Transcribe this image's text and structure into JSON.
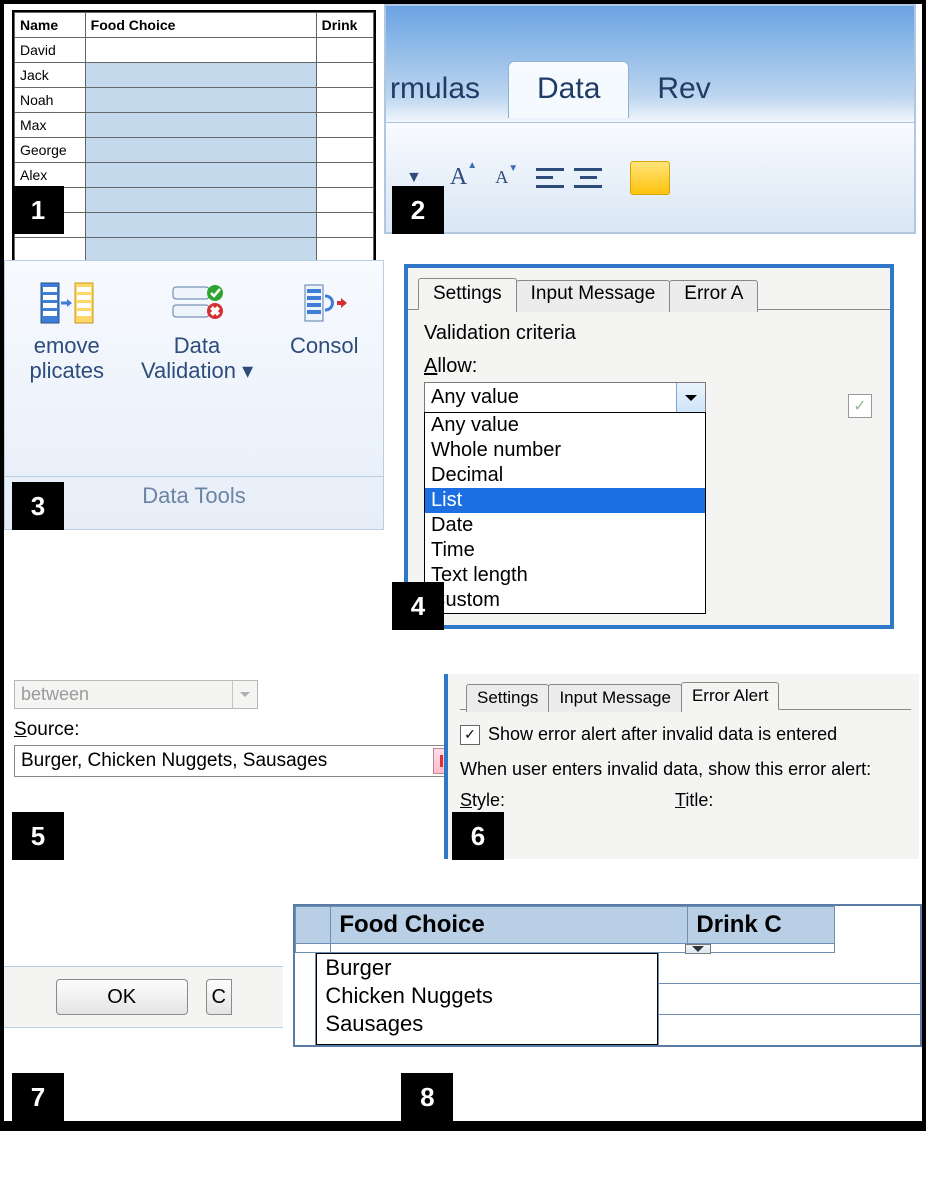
{
  "panel1": {
    "headers": {
      "name": "Name",
      "food": "Food Choice",
      "drink": "Drink"
    },
    "names": [
      "David",
      "Jack",
      "Noah",
      "Max",
      "George",
      "Alex"
    ]
  },
  "panel2": {
    "tabs": {
      "formulas": "rmulas",
      "data": "Data",
      "review": "Rev"
    }
  },
  "panel3": {
    "remove": "emove\nplicates",
    "validation": "Data\nValidation",
    "consolidate": "Consol",
    "group": "Data Tools"
  },
  "panel4": {
    "tabs": {
      "settings": "Settings",
      "input": "Input Message",
      "error": "Error A"
    },
    "section": "Validation criteria",
    "allow_label": "Allow:",
    "allow_value": "Any value",
    "options": [
      "Any value",
      "Whole number",
      "Decimal",
      "List",
      "Date",
      "Time",
      "Text length",
      "Custom"
    ],
    "highlight": "List"
  },
  "panel5": {
    "data_value": "between",
    "source_label": "Source:",
    "source_value": "Burger, Chicken Nuggets, Sausages"
  },
  "panel6": {
    "tabs": {
      "settings": "Settings",
      "input": "Input Message",
      "error": "Error Alert"
    },
    "checkbox": "Show error alert after invalid data is entered",
    "subtext": "When user enters invalid data, show this error alert:",
    "style": "Style:",
    "title": "Title:"
  },
  "panel7": {
    "ok": "OK",
    "cancel": "C"
  },
  "panel8": {
    "headers": {
      "food": "Food Choice",
      "drink": "Drink C"
    },
    "options": [
      "Burger",
      "Chicken Nuggets",
      "Sausages"
    ]
  },
  "badges": {
    "b1": "1",
    "b2": "2",
    "b3": "3",
    "b4": "4",
    "b5": "5",
    "b6": "6",
    "b7": "7",
    "b8": "8"
  }
}
